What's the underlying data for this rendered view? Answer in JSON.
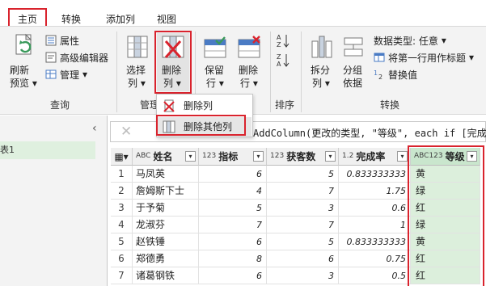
{
  "tabs": [
    {
      "label": "主页",
      "active": true
    },
    {
      "label": "转换",
      "active": false
    },
    {
      "label": "添加列",
      "active": false
    },
    {
      "label": "视图",
      "active": false
    }
  ],
  "ribbon": {
    "refresh_label_1": "刷新",
    "refresh_label_2": "预览",
    "properties": "属性",
    "advanced_editor": "高级编辑器",
    "manage": "管理",
    "query_group": "查询",
    "choose_cols_1": "选择",
    "choose_cols_2": "列",
    "remove_cols_1": "删除",
    "remove_cols_2": "列",
    "manage_cols_group": "管理",
    "keep_rows_1": "保留",
    "keep_rows_2": "行",
    "remove_rows_1": "删除",
    "remove_rows_2": "行",
    "sort_group": "排序",
    "split_col_1": "拆分",
    "split_col_2": "列",
    "group_by_1": "分组",
    "group_by_2": "依据",
    "data_type": "数据类型: 任意",
    "first_row_header": "将第一行用作标题",
    "replace_values": "替换值",
    "transform_group": "转换"
  },
  "menu": {
    "items": [
      {
        "label": "删除列"
      },
      {
        "label": "删除其他列"
      }
    ]
  },
  "nav": {
    "query_item": "表1"
  },
  "formula": {
    "text": "AddColumn(更改的类型, \"等级\", each if [完成率]"
  },
  "table": {
    "columns": [
      {
        "name": "姓名",
        "type_icon": "ABC"
      },
      {
        "name": "指标",
        "type_icon": "123"
      },
      {
        "name": "获客数",
        "type_icon": "123"
      },
      {
        "name": "完成率",
        "type_icon": "1.2"
      },
      {
        "name": "等级",
        "type_icon": "ABC123"
      }
    ],
    "rows": [
      {
        "n": "1",
        "name": "马凤英",
        "target": "6",
        "count": "5",
        "rate": "0.833333333",
        "grade": "黄"
      },
      {
        "n": "2",
        "name": "詹姆斯下士",
        "target": "4",
        "count": "7",
        "rate": "1.75",
        "grade": "绿"
      },
      {
        "n": "3",
        "name": "于予菊",
        "target": "5",
        "count": "3",
        "rate": "0.6",
        "grade": "红"
      },
      {
        "n": "4",
        "name": "龙淑芬",
        "target": "7",
        "count": "7",
        "rate": "1",
        "grade": "绿"
      },
      {
        "n": "5",
        "name": "赵铁锤",
        "target": "6",
        "count": "5",
        "rate": "0.833333333",
        "grade": "黄"
      },
      {
        "n": "6",
        "name": "郑德勇",
        "target": "8",
        "count": "6",
        "rate": "0.75",
        "grade": "红"
      },
      {
        "n": "7",
        "name": "诸葛钢铁",
        "target": "6",
        "count": "3",
        "rate": "0.5",
        "grade": "红"
      }
    ]
  },
  "colors": {
    "highlight_red": "#d9232d",
    "grade_bg": "#dcefdc",
    "accent_green": "#3a9a5b"
  }
}
